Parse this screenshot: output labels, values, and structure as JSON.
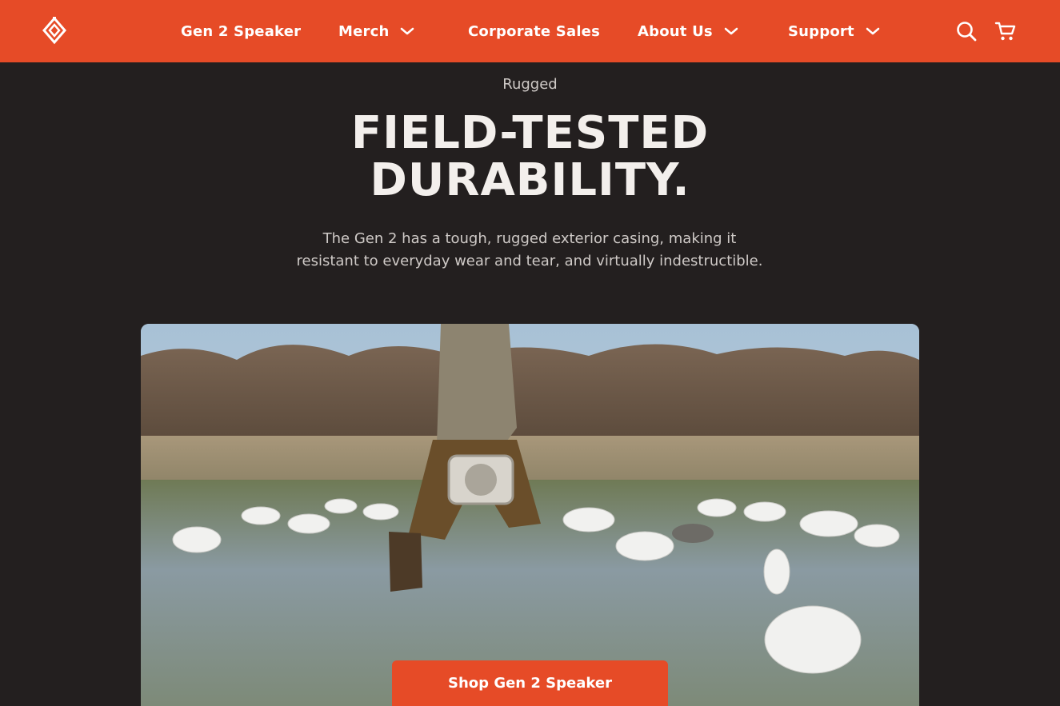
{
  "nav": {
    "logo_icon": "diamond-logo-icon",
    "links": [
      {
        "label": "Gen 2 Speaker",
        "has_dropdown": false
      },
      {
        "label": "Merch",
        "has_dropdown": true
      },
      {
        "label": "Corporate Sales",
        "has_dropdown": false
      },
      {
        "label": "About Us",
        "has_dropdown": true
      },
      {
        "label": "Support",
        "has_dropdown": true
      }
    ],
    "icons": [
      "search-icon",
      "cart-icon"
    ]
  },
  "section": {
    "eyebrow": "Rugged",
    "headline_line1": "FIELD-TESTED",
    "headline_line2": "DURABILITY.",
    "body_line1": "The Gen 2 has a tough, rugged exterior casing, making it",
    "body_line2": "resistant to everyday wear and tear, and virtually indestructible."
  },
  "cta": {
    "label": "Shop Gen 2 Speaker"
  },
  "colors": {
    "accent": "#e64b27",
    "background": "#231f1f",
    "headline": "#f3efec",
    "body_text": "#cfcac7"
  }
}
